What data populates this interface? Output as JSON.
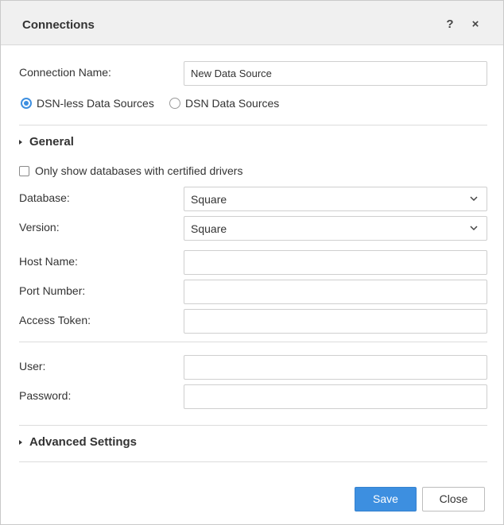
{
  "dialog": {
    "title": "Connections",
    "help_glyph": "?",
    "close_glyph": "×"
  },
  "connection_name": {
    "label": "Connection Name:",
    "value": "New Data Source"
  },
  "source_type": {
    "options": [
      {
        "label": "DSN-less Data Sources",
        "selected": true
      },
      {
        "label": "DSN Data Sources",
        "selected": false
      }
    ]
  },
  "general": {
    "title": "General",
    "expanded": true,
    "certified_only": {
      "label": "Only show databases with certified drivers",
      "checked": false
    },
    "database": {
      "label": "Database:",
      "value": "Square"
    },
    "version": {
      "label": "Version:",
      "value": "Square"
    },
    "host_name": {
      "label": "Host Name:",
      "value": ""
    },
    "port_number": {
      "label": "Port Number:",
      "value": ""
    },
    "access_token": {
      "label": "Access Token:",
      "value": ""
    },
    "user": {
      "label": "User:",
      "value": ""
    },
    "password": {
      "label": "Password:",
      "value": ""
    }
  },
  "advanced": {
    "title": "Advanced Settings",
    "expanded": false
  },
  "footer": {
    "save_label": "Save",
    "close_label": "Close"
  },
  "colors": {
    "accent": "#3d8fe0",
    "titlebar_bg": "#f0f0f0",
    "border": "#cfcfcf",
    "text": "#333333"
  }
}
